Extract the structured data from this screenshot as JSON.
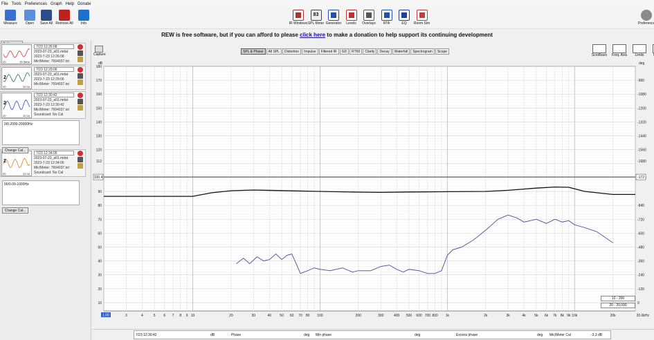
{
  "menu": [
    "File",
    "Tools",
    "Preferences",
    "Graph",
    "Help",
    "Donate"
  ],
  "toolbar_left": [
    {
      "label": "Measure",
      "icon": "measure-icon",
      "color": "#3a6fd0"
    },
    {
      "label": "Open",
      "icon": "open-folder-icon",
      "color": "#5b8fd8"
    },
    {
      "label": "Save All",
      "icon": "save-icon",
      "color": "#2c4c8c"
    },
    {
      "label": "Remove All",
      "icon": "remove-all-icon",
      "color": "#c02020"
    },
    {
      "label": "Info",
      "icon": "info-icon",
      "color": "#1d6fd0"
    }
  ],
  "toolbar_center": [
    {
      "label": "IR Windows",
      "icon": "ir-windows-icon",
      "color": "#b03030"
    },
    {
      "label": "SPL Meter",
      "icon": "spl-meter-icon",
      "color": "#444444",
      "value": "83"
    },
    {
      "label": "Generator",
      "icon": "generator-icon",
      "color": "#2050b0"
    },
    {
      "label": "Levels",
      "icon": "levels-icon",
      "color": "#c03030"
    },
    {
      "label": "Overlays",
      "icon": "overlays-icon",
      "color": "#555555"
    },
    {
      "label": "RTA",
      "icon": "rta-icon",
      "color": "#2050b0"
    },
    {
      "label": "EQ",
      "icon": "eq-icon",
      "color": "#2040a0"
    },
    {
      "label": "Room Sim",
      "icon": "room-sim-icon",
      "color": "#c04040"
    }
  ],
  "toolbar_right_label": "Preferences",
  "banner": {
    "pre": "REW is free software, but if you can afford to please ",
    "link": "click here",
    "post": " to make a donation to help support its continuing development"
  },
  "left_panel": {
    "collapse_label": "Collapse",
    "measurements": [
      {
        "num": "",
        "date": "7/23 12:26:08",
        "name": "2023-07-23_a01.mdat",
        "time": "2023-7-23 12:26:08",
        "mic": "Mic/Meter: 7694037.txt",
        "soundcard": "",
        "f1": "20",
        "f2": "20.0kHz",
        "trace_color": "#d03030"
      },
      {
        "num": "2",
        "date": "7/23 12:29:06",
        "name": "2023-07-23_a01.mdat",
        "time": "2023-7-23 12:29:06",
        "mic": "Mic/Meter: 7694037.txt",
        "soundcard": "",
        "f1": "20",
        "f2": "22.1k",
        "trace_color": "#208040"
      },
      {
        "num": "2",
        "date": "7/23 12:30:42",
        "name": "2023-07-23_a01.mdat",
        "time": "2023-7-23 12:30:42",
        "mic": "Mic/Meter: 7694037.txt",
        "soundcard": "Soundcard: No Cal",
        "f1": "20",
        "f2": "22.1k",
        "trace_color": "#3050c0"
      },
      {
        "num": "2",
        "date": "7/23 12:34:06",
        "name": "2023-07-23_a01.mdat",
        "time": "2023-7-23 12:34:06",
        "mic": "Mic/Meter: 7694037.txt",
        "soundcard": "Soundcard: No Cal",
        "f1": "20",
        "f2": "22.1k",
        "trace_color": "#e08020"
      }
    ],
    "cal_boxes": [
      {
        "text": "0/0.2000-20000Hz",
        "button": "Change Cal..."
      },
      {
        "text": "00/0.00-1000Hz",
        "button": "Change Cal..."
      }
    ]
  },
  "graph": {
    "capture_label": "Capture",
    "tabs": [
      "SPL & Phase",
      "All SPL",
      "Distortion",
      "Impulse",
      "Filtered IR",
      "GD",
      "RT60",
      "Clarity",
      "Decay",
      "Waterfall",
      "Spectrogram",
      "Scope"
    ],
    "active_tab": "SPL & Phase",
    "right_tools": [
      "Scrollbars",
      "Freq. Axis",
      "Limits",
      "Controls"
    ],
    "y_unit_left": "dB",
    "y_unit_right": "deg",
    "cursor_left": "100.4",
    "cursor_right": "-172",
    "range_buttons": [
      "10 - 200",
      "20 - 20,000"
    ],
    "x_cursor": "1.00",
    "bottom_right": "20.0kHz"
  },
  "chart_data": {
    "type": "line",
    "xscale": "log",
    "xlim": [
      2,
      30000
    ],
    "ylim": [
      4,
      180
    ],
    "x_ticks": [
      "3",
      "4",
      "5",
      "6",
      "7",
      "8",
      "9",
      "10",
      "20",
      "30",
      "40",
      "50",
      "60",
      "70",
      "80",
      "100",
      "200",
      "300",
      "400",
      "500",
      "600",
      "700",
      "800",
      "1k",
      "2k",
      "3k",
      "4k",
      "5k",
      "6k",
      "7k",
      "8k",
      "9k",
      "10k",
      "20k"
    ],
    "y_ticks_left": [
      10,
      20,
      30,
      40,
      50,
      60,
      70,
      80,
      90,
      100,
      112,
      120,
      130,
      140,
      150,
      160,
      170,
      180
    ],
    "y_ticks_right": [
      "-960",
      "-1080",
      "-1200",
      "-1320",
      "-1440",
      "-1560",
      "-1680",
      "-1800",
      "-840",
      "-720",
      "-600",
      "-480",
      "-360",
      "-240",
      "-120",
      "0",
      "-172"
    ],
    "series": [
      {
        "color": "#111111",
        "x": [
          2,
          8,
          10,
          14,
          20,
          30,
          50,
          100,
          200,
          300,
          500,
          1000,
          2000,
          3000,
          5000,
          7000,
          9000,
          12000,
          20000,
          30000
        ],
        "y": [
          86.5,
          86.5,
          86.5,
          89,
          90.5,
          91,
          90.6,
          90.0,
          89.5,
          89.3,
          89.6,
          89.8,
          90.0,
          90.8,
          92.4,
          93.2,
          93.0,
          90.0,
          87.8,
          87.8
        ]
      },
      {
        "color": "#5858a8",
        "x": [
          22,
          25,
          28,
          32,
          36,
          40,
          45,
          50,
          55,
          60,
          65,
          70,
          80,
          90,
          100,
          120,
          150,
          180,
          200,
          250,
          300,
          350,
          400,
          450,
          500,
          600,
          700,
          800,
          900,
          1000,
          1100,
          1300,
          1600,
          2000,
          2500,
          3000,
          3500,
          4000,
          4500,
          5000,
          6000,
          7000,
          8000,
          9000,
          10000,
          12000,
          15000,
          20000
        ],
        "y": [
          38,
          42,
          38,
          43,
          40,
          41,
          45,
          41,
          44,
          45,
          38,
          31,
          33,
          35,
          34,
          33,
          35,
          32,
          33,
          33,
          36,
          37,
          34,
          32,
          34,
          33,
          31,
          31,
          33,
          44,
          48,
          50,
          55,
          62,
          70,
          73,
          71,
          68,
          69,
          70,
          67,
          70,
          68,
          69,
          66,
          64,
          61,
          53
        ]
      }
    ]
  },
  "legend": {
    "items": [
      {
        "label": "7/23 12:30:42"
      },
      {
        "label": "dB"
      },
      {
        "label": "Phase"
      },
      {
        "label": "deg"
      },
      {
        "label": "Min phase"
      },
      {
        "label": "deg"
      },
      {
        "label": "Excess phase"
      },
      {
        "label": "deg"
      },
      {
        "label": "Mic/Meter Cal"
      },
      {
        "label": "-3.3 dB"
      }
    ]
  }
}
